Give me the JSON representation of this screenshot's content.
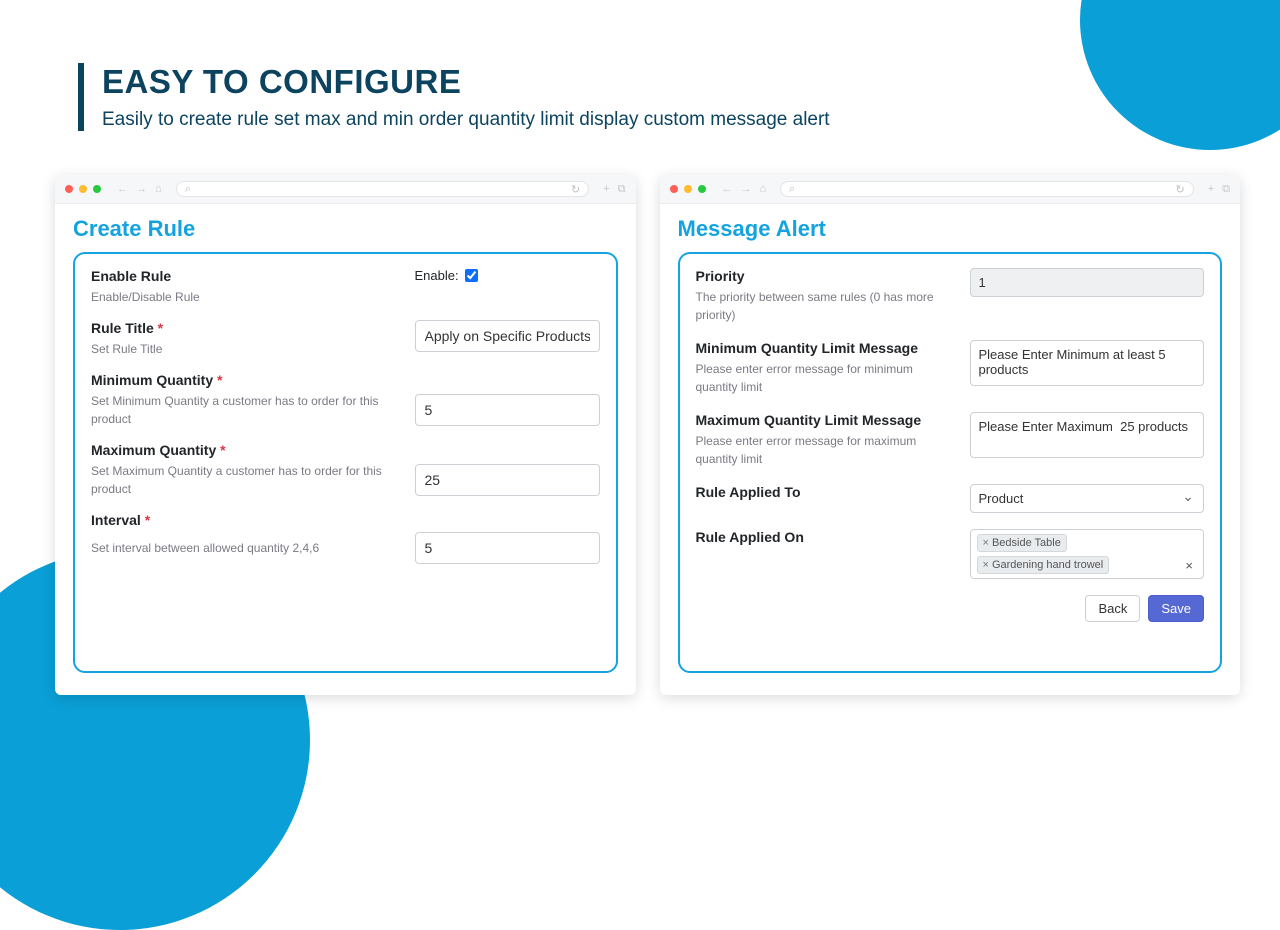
{
  "hero": {
    "title": "EASY TO CONFIGURE",
    "subtitle": "Easily to create rule set max and min order quantity limit display custom message alert"
  },
  "left": {
    "title": "Create Rule",
    "enable": {
      "label": "Enable Rule",
      "hint": "Enable/Disable Rule",
      "toggle_label": "Enable:",
      "checked": true
    },
    "ruleTitle": {
      "label": "Rule Title",
      "hint": "Set Rule Title",
      "value": "Apply on Specific Products"
    },
    "minQty": {
      "label": "Minimum Quantity",
      "hint": "Set Minimum Quantity a customer has to order for this product",
      "value": "5"
    },
    "maxQty": {
      "label": "Maximum Quantity",
      "hint": "Set Maximum Quantity a customer has to order for this product",
      "value": "25"
    },
    "interval": {
      "label": "Interval",
      "hint": "Set interval between allowed quantity 2,4,6",
      "value": "5"
    }
  },
  "right": {
    "title": "Message Alert",
    "priority": {
      "label": "Priority",
      "hint": "The priority between same rules (0 has more priority)",
      "value": "1"
    },
    "minMsg": {
      "label": "Minimum Quantity Limit Message",
      "hint": "Please enter error message for minimum quantity limit",
      "value": "Please Enter Minimum at least 5 products"
    },
    "maxMsg": {
      "label": "Maximum Quantity Limit Message",
      "hint": "Please enter error message for maximum quantity limit",
      "value": "Please Enter Maximum  25 products"
    },
    "appliedTo": {
      "label": "Rule Applied To",
      "value": "Product"
    },
    "appliedOn": {
      "label": "Rule Applied On",
      "tags": [
        "Bedside Table",
        "Gardening hand trowel"
      ]
    },
    "buttons": {
      "back": "Back",
      "save": "Save"
    }
  }
}
